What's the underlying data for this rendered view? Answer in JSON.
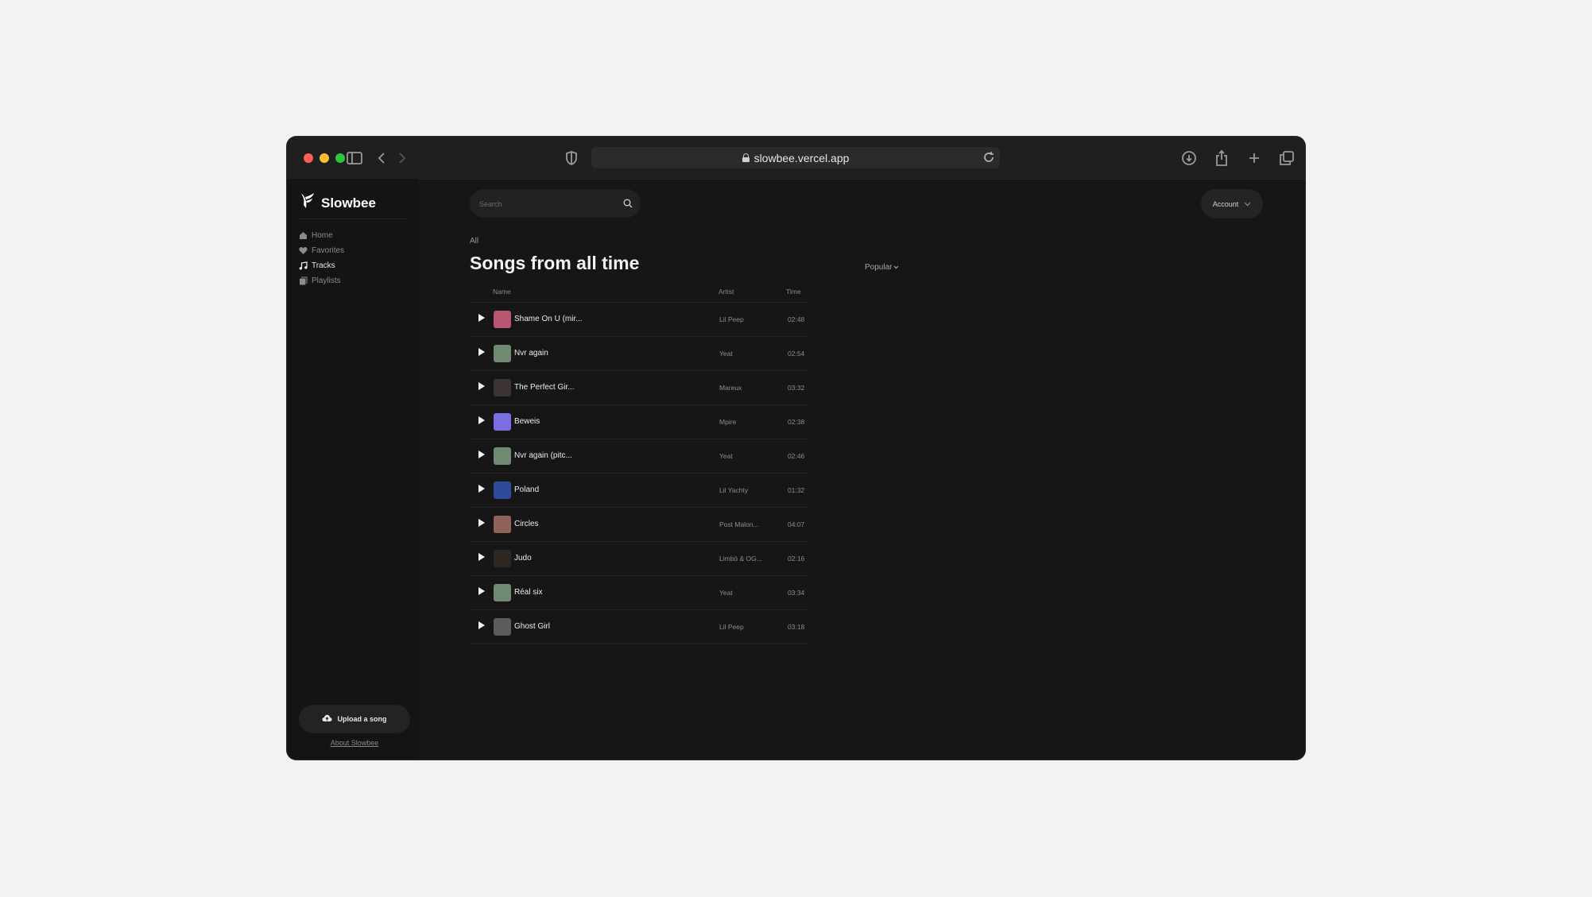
{
  "browser": {
    "url": "slowbee.vercel.app"
  },
  "sidebar": {
    "logo": "Slowbee",
    "items": [
      {
        "label": "Home",
        "icon": "home-icon"
      },
      {
        "label": "Favorites",
        "icon": "heart-icon"
      },
      {
        "label": "Tracks",
        "icon": "music-note-icon",
        "active": true
      },
      {
        "label": "Playlists",
        "icon": "playlist-icon"
      }
    ],
    "upload_label": "Upload a song",
    "about_label": "About Slowbee"
  },
  "header": {
    "search_placeholder": "Search",
    "account_label": "Account"
  },
  "main": {
    "breadcrumb": "All",
    "title": "Songs from all time",
    "sort_label": "Popular",
    "columns": {
      "name": "Name",
      "artist": "Artist",
      "time": "Time"
    },
    "tracks": [
      {
        "name": "Shame On U (mir...",
        "artist": "Lil Peep",
        "time": "02:48",
        "thumb": "#b8566f"
      },
      {
        "name": "Nvr again",
        "artist": "Yeat",
        "time": "02:54",
        "thumb": "#6f8a70"
      },
      {
        "name": "The Perfect Gir...",
        "artist": "Mareux",
        "time": "03:32",
        "thumb": "#3d3432"
      },
      {
        "name": "Beweis",
        "artist": "Mpire",
        "time": "02:38",
        "thumb": "#7a6fe0"
      },
      {
        "name": "Nvr again (pitc...",
        "artist": "Yeat",
        "time": "02:46",
        "thumb": "#6f8a70"
      },
      {
        "name": "Poland",
        "artist": "Lil Yachty",
        "time": "01:32",
        "thumb": "#2c4b9a"
      },
      {
        "name": "Circles",
        "artist": "Post Malon...",
        "time": "04:07",
        "thumb": "#8f6458"
      },
      {
        "name": "Judo",
        "artist": "Limbö & OG...",
        "time": "02:16",
        "thumb": "#2e2621"
      },
      {
        "name": "Réal six",
        "artist": "Yeat",
        "time": "03:34",
        "thumb": "#6f8a70"
      },
      {
        "name": "Ghost Girl",
        "artist": "Lil Peep",
        "time": "03:18",
        "thumb": "#5c5c5c"
      }
    ]
  }
}
